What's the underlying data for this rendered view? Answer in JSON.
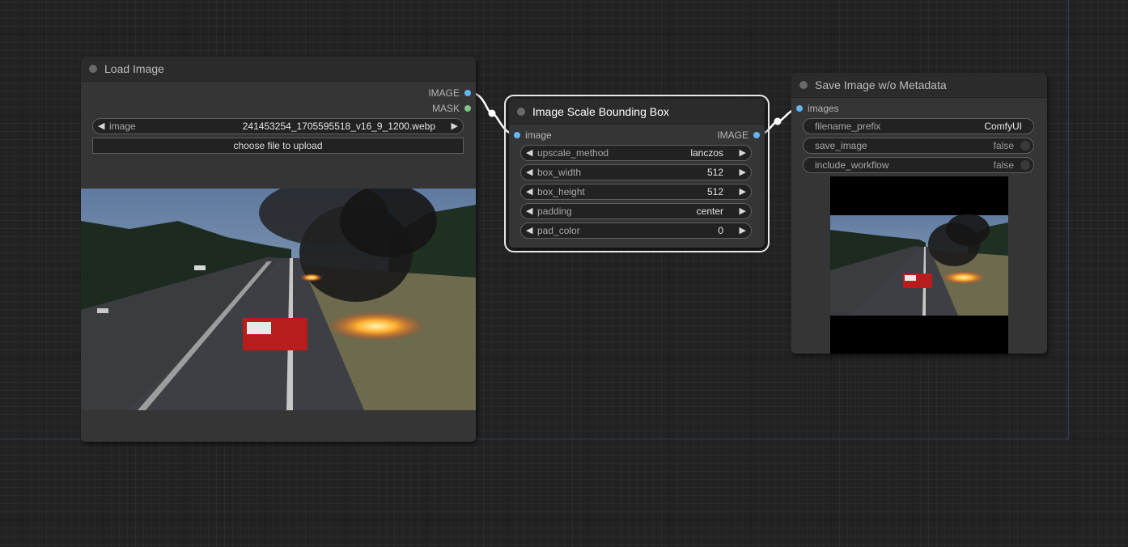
{
  "colors": {
    "canvas_bg": "#222222",
    "node_bg": "#353535",
    "node_title_bg": "#2b2b2b",
    "image_slot": "#64b5f6",
    "mask_slot": "#81c784",
    "link": "#ffffff",
    "selected_outline": "#e6e6e6"
  },
  "nodes": {
    "load_image": {
      "title": "Load Image",
      "outputs": [
        {
          "label": "IMAGE",
          "type": "IMAGE"
        },
        {
          "label": "MASK",
          "type": "MASK"
        }
      ],
      "image_widget": {
        "label": "image",
        "value": "241453254_1705595518_v16_9_1200.webp"
      },
      "upload_button": "choose file to upload",
      "preview_icon": "photo-highway-truck-fire"
    },
    "scale_bbox": {
      "title": "Image Scale Bounding Box",
      "input": {
        "label": "image"
      },
      "output": {
        "label": "IMAGE"
      },
      "widgets": [
        {
          "label": "upscale_method",
          "value": "lanczos"
        },
        {
          "label": "box_width",
          "value": "512"
        },
        {
          "label": "box_height",
          "value": "512"
        },
        {
          "label": "padding",
          "value": "center"
        },
        {
          "label": "pad_color",
          "value": "0"
        }
      ]
    },
    "save_image": {
      "title": "Save Image w/o Metadata",
      "input": {
        "label": "images"
      },
      "widgets": [
        {
          "label": "filename_prefix",
          "value": "ComfyUI"
        },
        {
          "label": "save_image",
          "value": "false"
        },
        {
          "label": "include_workflow",
          "value": "false"
        }
      ],
      "preview_icon": "photo-letterboxed-result"
    }
  }
}
